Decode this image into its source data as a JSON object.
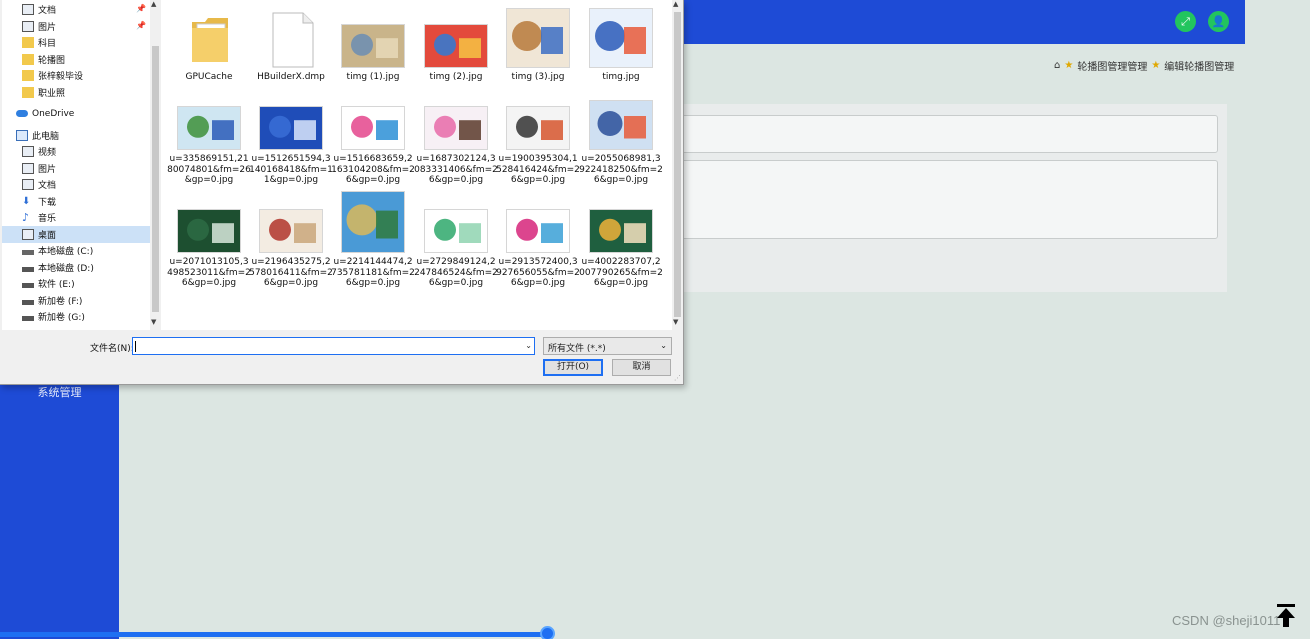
{
  "nav": {
    "quick": [
      {
        "label": "文档",
        "icon": "documents-icon",
        "pinned": true
      },
      {
        "label": "图片",
        "icon": "pictures-icon",
        "pinned": true
      },
      {
        "label": "科目",
        "icon": "folder-icon",
        "pinned": false
      },
      {
        "label": "轮播图",
        "icon": "folder-icon",
        "pinned": false
      },
      {
        "label": "张梓毅毕设",
        "icon": "folder-icon",
        "pinned": false
      },
      {
        "label": "职业照",
        "icon": "folder-icon",
        "pinned": false
      }
    ],
    "onedrive": "OneDrive",
    "this_pc": "此电脑",
    "pc_items": [
      {
        "label": "视频",
        "icon": "videos-icon"
      },
      {
        "label": "图片",
        "icon": "pictures-icon"
      },
      {
        "label": "文档",
        "icon": "documents-icon"
      },
      {
        "label": "下载",
        "icon": "downloads-icon"
      },
      {
        "label": "音乐",
        "icon": "music-icon"
      },
      {
        "label": "桌面",
        "icon": "desktop-icon",
        "selected": true
      },
      {
        "label": "本地磁盘 (C:)",
        "icon": "drive-c-icon"
      },
      {
        "label": "本地磁盘 (D:)",
        "icon": "drive-icon"
      },
      {
        "label": "软件 (E:)",
        "icon": "drive-icon"
      },
      {
        "label": "新加卷 (F:)",
        "icon": "drive-icon"
      },
      {
        "label": "新加卷 (G:)",
        "icon": "drive-icon"
      }
    ]
  },
  "files": [
    {
      "name": "GPUCache",
      "kind": "folder"
    },
    {
      "name": "HBuilderX.dmp",
      "kind": "doc"
    },
    {
      "name": "timg (1).jpg",
      "kind": "img",
      "colors": [
        "#c9b48a",
        "#6b8db3",
        "#e8d9b8"
      ]
    },
    {
      "name": "timg (2).jpg",
      "kind": "img",
      "colors": [
        "#e34a3c",
        "#2e7bd6",
        "#f6c343"
      ]
    },
    {
      "name": "timg (3).jpg",
      "kind": "img",
      "colors": [
        "#f0e6d6",
        "#b7793b",
        "#3c6dc4"
      ]
    },
    {
      "name": "timg.jpg",
      "kind": "img",
      "colors": [
        "#e9f1fb",
        "#2a5bb8",
        "#e85b3a"
      ]
    },
    {
      "name": "u=335869151,2180074801&fm=26&gp=0.jpg",
      "kind": "img",
      "colors": [
        "#cfe6f2",
        "#3d8f3a",
        "#2a5bb8"
      ]
    },
    {
      "name": "u=1512651594,3140168418&fm=11&gp=0.jpg",
      "kind": "img",
      "colors": [
        "#1f4db8",
        "#3a6fd6",
        "#dbe6fa"
      ]
    },
    {
      "name": "u=1516683659,2163104208&fm=26&gp=0.jpg",
      "kind": "img",
      "colors": [
        "#ffffff",
        "#e4458c",
        "#2c8fd6"
      ]
    },
    {
      "name": "u=1687302124,3083331406&fm=26&gp=0.jpg",
      "kind": "img",
      "colors": [
        "#f7f0f5",
        "#e86aa8",
        "#5b3a2a"
      ]
    },
    {
      "name": "u=1900395304,1528416424&fm=26&gp=0.jpg",
      "kind": "img",
      "colors": [
        "#f4f4f4",
        "#333333",
        "#d6552d"
      ]
    },
    {
      "name": "u=2055068981,3922418250&fm=26&gp=0.jpg",
      "kind": "img",
      "colors": [
        "#cfe0f2",
        "#2a4f9a",
        "#e85b3a"
      ]
    },
    {
      "name": "u=2071013105,3498523011&fm=26&gp=0.jpg",
      "kind": "img",
      "colors": [
        "#1d4f30",
        "#2d6b44",
        "#d8e8dc"
      ]
    },
    {
      "name": "u=2196435275,2578016411&fm=26&gp=0.jpg",
      "kind": "img",
      "colors": [
        "#f3ece2",
        "#b0352a",
        "#c9a77a"
      ]
    },
    {
      "name": "u=2214144474,2735781181&fm=26&gp=0.jpg",
      "kind": "img",
      "colors": [
        "#4a9ad6",
        "#d9b95a",
        "#2f7a3d"
      ]
    },
    {
      "name": "u=2729849124,2247846524&fm=26&gp=0.jpg",
      "kind": "img",
      "colors": [
        "#ffffff",
        "#2ea86b",
        "#8fd3b0"
      ]
    },
    {
      "name": "u=2913572400,3927656055&fm=26&gp=0.jpg",
      "kind": "img",
      "colors": [
        "#ffffff",
        "#d6247a",
        "#3aa0d6"
      ]
    },
    {
      "name": "u=4002283707,2007790265&fm=26&gp=0.jpg",
      "kind": "img",
      "colors": [
        "#1f5f3f",
        "#f0b23a",
        "#f6e2c0"
      ]
    }
  ],
  "dialog": {
    "filename_label": "文件名(N):",
    "filename_value": "",
    "filetype": "所有文件 (*.*)",
    "open_button": "打开(O)",
    "cancel_button": "取消"
  },
  "app": {
    "sidebar_item": "系统管理",
    "breadcrumb": [
      "轮播图管理管理",
      "编辑轮播图管理"
    ],
    "watermark": "CSDN @sheji1011",
    "accent": "#1e4bd6",
    "header_button_color": "#22c55e"
  }
}
